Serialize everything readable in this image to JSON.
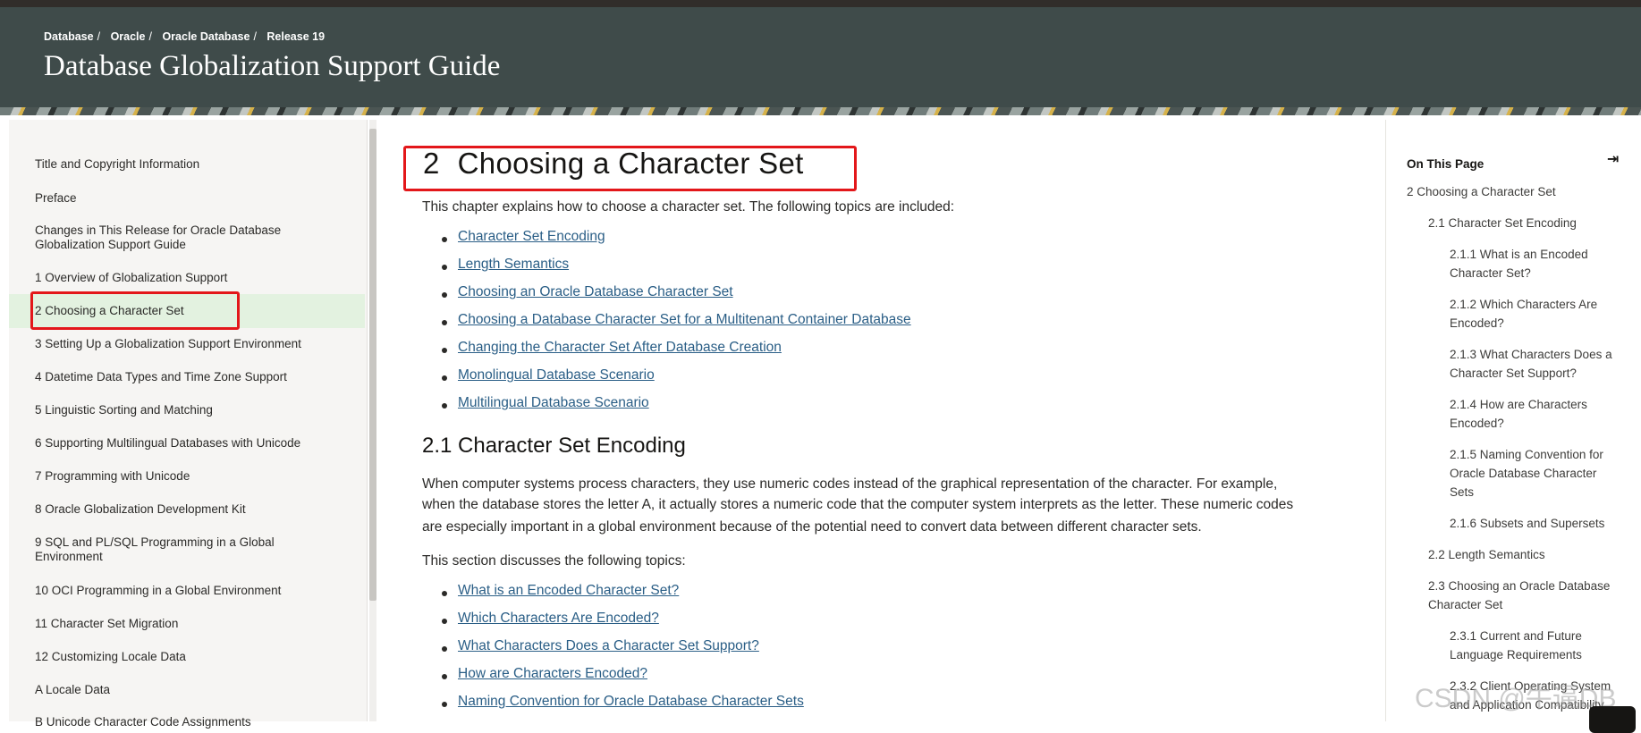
{
  "header": {
    "breadcrumbs": [
      "Database",
      "Oracle",
      "Oracle Database",
      "Release 19"
    ],
    "title": "Database Globalization Support Guide"
  },
  "sidebar": {
    "items": [
      "Title and Copyright Information",
      "Preface",
      "Changes in This Release for Oracle Database Globalization Support Guide",
      "1  Overview of Globalization Support",
      "2  Choosing a Character Set",
      "3  Setting Up a Globalization Support Environment",
      "4  Datetime Data Types and Time Zone Support",
      "5  Linguistic Sorting and Matching",
      "6  Supporting Multilingual Databases with Unicode",
      "7  Programming with Unicode",
      "8  Oracle Globalization Development Kit",
      "9  SQL and PL/SQL Programming in a Global Environment",
      "10  OCI Programming in a Global Environment",
      "11  Character Set Migration",
      "12  Customizing Locale Data",
      "A  Locale Data",
      "B  Unicode Character Code Assignments"
    ],
    "active_index": 4
  },
  "main": {
    "chapter_number": "2",
    "chapter_title": "Choosing a Character Set",
    "intro": "This chapter explains how to choose a character set. The following topics are included:",
    "topics": [
      "Character Set Encoding",
      "Length Semantics",
      "Choosing an Oracle Database Character Set",
      "Choosing a Database Character Set for a Multitenant Container Database",
      "Changing the Character Set After Database Creation",
      "Monolingual Database Scenario",
      "Multilingual Database Scenario"
    ],
    "section_title": "2.1 Character Set Encoding",
    "section_para_lines": [
      "When computer systems process characters, they use numeric codes instead of the graphical representation of the character. For example,",
      "when the database stores the letter A, it actually stores a numeric code that the computer system interprets as the letter. These numeric codes",
      "are especially important in a global environment because of the potential need to convert data between different character sets."
    ],
    "section_intro": "This section discusses the following topics:",
    "section_topics": [
      "What is an Encoded Character Set?",
      "Which Characters Are Encoded?",
      "What Characters Does a Character Set Support?",
      "How are Characters Encoded?",
      "Naming Convention for Oracle Database Character Sets"
    ]
  },
  "on_this_page": {
    "heading": "On This Page",
    "collapse_glyph": "⇥",
    "items": [
      {
        "text": "2 Choosing a Character Set",
        "level": 0
      },
      {
        "text": "2.1 Character Set Encoding",
        "level": 1
      },
      {
        "text": "2.1.1 What is an Encoded Character Set?",
        "level": 2
      },
      {
        "text": "2.1.2 Which Characters Are Encoded?",
        "level": 2
      },
      {
        "text": "2.1.3 What Characters Does a Character Set Support?",
        "level": 2
      },
      {
        "text": "2.1.4 How are Characters Encoded?",
        "level": 2
      },
      {
        "text": "2.1.5 Naming Convention for Oracle Database Character Sets",
        "level": 2
      },
      {
        "text": "2.1.6 Subsets and Supersets",
        "level": 2
      },
      {
        "text": "2.2 Length Semantics",
        "level": 1
      },
      {
        "text": "2.3 Choosing an Oracle Database Character Set",
        "level": 1
      },
      {
        "text": "2.3.1 Current and Future Language Requirements",
        "level": 2
      },
      {
        "text": "2.3.2 Client Operating System and Application Compatibility",
        "level": 2
      }
    ]
  },
  "watermark": "CSDN @牛逼DB",
  "colors": {
    "header_bg": "#3f4b4a",
    "link": "#2a5e86",
    "active_bg": "#e3f2e0",
    "highlight_box": "#e3171a"
  }
}
